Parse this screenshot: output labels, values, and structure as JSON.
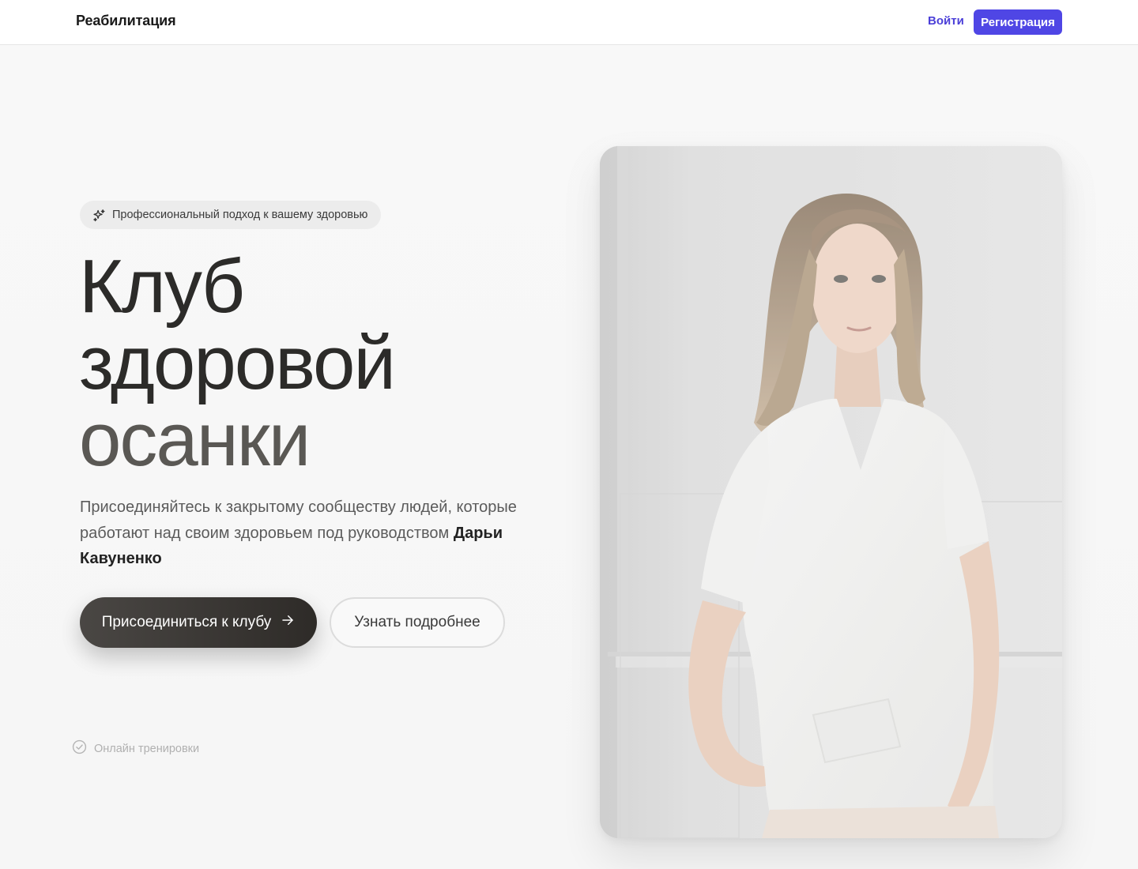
{
  "header": {
    "brand": "Реабилитация",
    "login_label": "Войти",
    "register_label": "Регистрация"
  },
  "hero": {
    "badge_icon": "sparkles-icon",
    "badge_text": "Профессиональный подход к вашему здоровью",
    "title_line1": "Клуб",
    "title_line2": "здоровой",
    "title_line3": "осанки",
    "lead_text": "Присоединяйтесь к закрытому сообществу людей, которые работают над своим здоровьем под руководством ",
    "lead_name": "Дарьи Кавуненко",
    "join_label": "Присоединиться к клубу",
    "join_icon": "arrow-right-icon",
    "more_label": "Узнать подробнее",
    "feature_icon": "check-circle-icon",
    "feature_text": "Онлайн тренировки"
  },
  "colors": {
    "accent": "#4f46e5",
    "dark_button": "#2e2b28"
  }
}
